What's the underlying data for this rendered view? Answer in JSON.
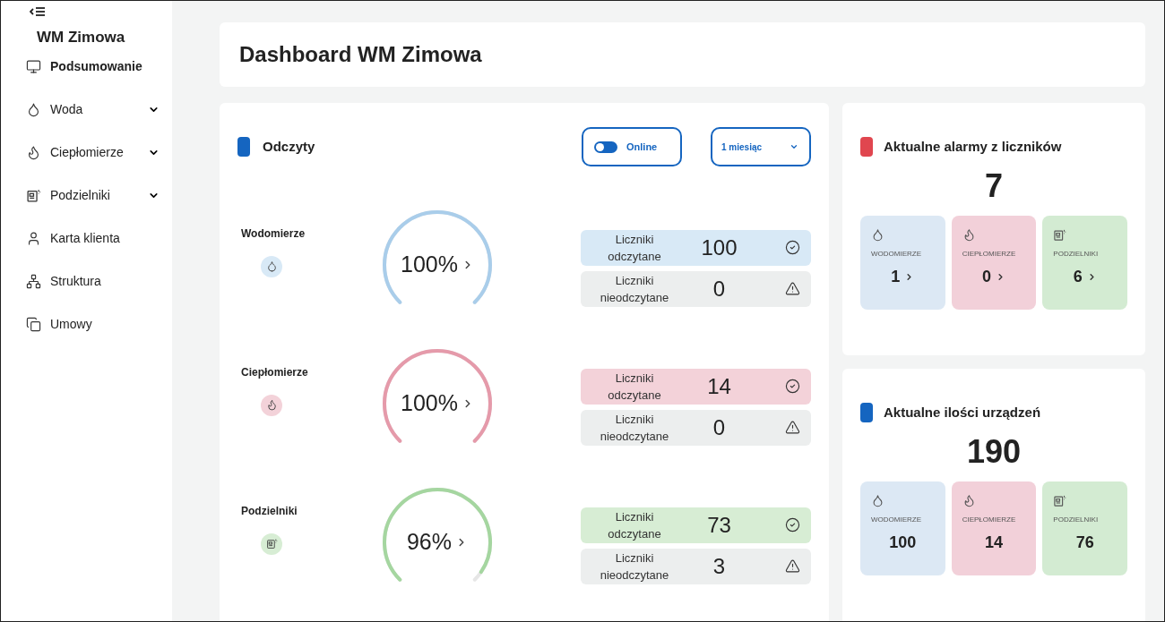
{
  "sidebar": {
    "brand": "WM Zimowa",
    "items": [
      {
        "label": "Podsumowanie",
        "selected": true
      },
      {
        "label": "Woda",
        "selected": false,
        "expanded": false
      },
      {
        "label": "Ciepłomierze",
        "selected": false,
        "expanded": false
      },
      {
        "label": "Podzielniki",
        "selected": false,
        "expanded": false
      },
      {
        "label": "Karta klienta",
        "selected": false
      },
      {
        "label": "Struktura",
        "selected": false
      },
      {
        "label": "Umowy",
        "selected": false
      }
    ]
  },
  "header": {
    "title": "Dashboard WM Zimowa"
  },
  "readings": {
    "title": "Odczyty",
    "color": "#1565c0",
    "online": {
      "label": "Online",
      "on": true
    },
    "period": {
      "value": "1 miesiąc"
    },
    "groups": [
      {
        "name": "Wodomierze",
        "color": "#a9cdea",
        "level": 1,
        "percent": "100%",
        "read": {
          "label": "Liczniki odczytane",
          "value": "100"
        },
        "unread": {
          "label": "Liczniki nieodczytane",
          "value": "0"
        }
      },
      {
        "name": "Ciepłomierze",
        "color": "#e59aaa",
        "level": 1,
        "percent": "100%",
        "read": {
          "label": "Liczniki odczytane",
          "value": "14"
        },
        "unread": {
          "label": "Liczniki nieodczytane",
          "value": "0"
        }
      },
      {
        "name": "Podzielniki",
        "color": "#a5d6a0",
        "level": 0.96,
        "percent": "96%",
        "read": {
          "label": "Liczniki odczytane",
          "value": "73"
        },
        "unread": {
          "label": "Liczniki nieodczytane",
          "value": "3"
        }
      }
    ]
  },
  "alarms": {
    "title": "Aktualne alarmy z liczników",
    "color": "#e0464f",
    "total": "7",
    "tiles": [
      {
        "label": "WODOMIERZE",
        "value": "1",
        "color": "#dce8f4",
        "link": true
      },
      {
        "label": "CIEPŁOMIERZE",
        "value": "0",
        "color": "#f2d0d9",
        "link": true
      },
      {
        "label": "PODZIELNIKI",
        "value": "6",
        "color": "#d3ebd2",
        "link": true
      }
    ]
  },
  "devices": {
    "title": "Aktualne ilości urządzeń",
    "color": "#1565c0",
    "total": "190",
    "tiles": [
      {
        "label": "WODOMIERZE",
        "value": "100",
        "color": "#dce8f4",
        "link": false
      },
      {
        "label": "CIEPŁOMIERZE",
        "value": "14",
        "color": "#f2d0d9",
        "link": false
      },
      {
        "label": "PODZIELNIKI",
        "value": "76",
        "color": "#d3ebd2",
        "link": false
      }
    ]
  }
}
